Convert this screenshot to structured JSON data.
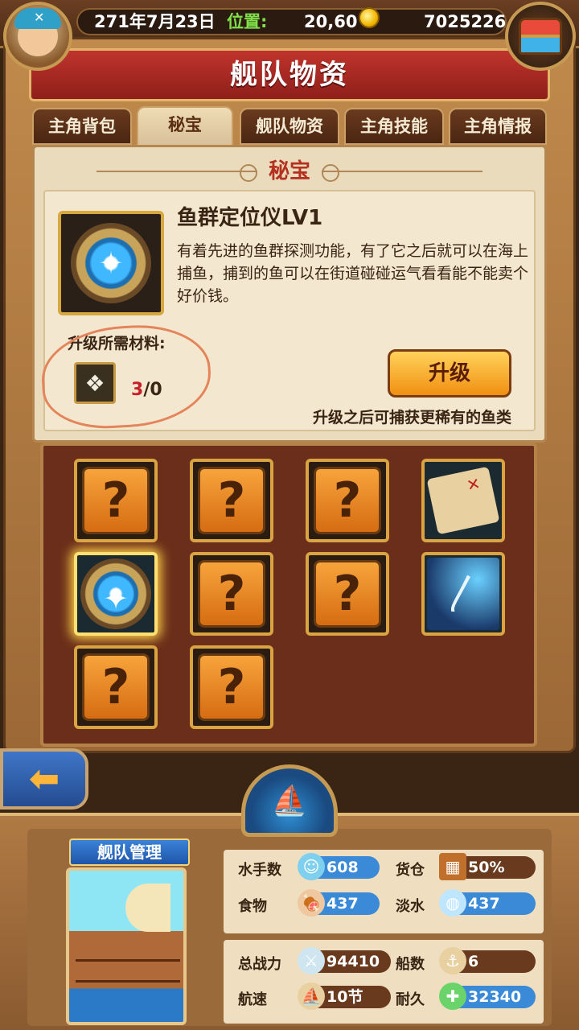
{
  "header": {
    "date": "271年7月23日",
    "position_label": "位置:",
    "position_value": "20,60",
    "gold": "7025226"
  },
  "title": "舰队物资",
  "tabs": [
    {
      "label": "主角背包",
      "active": false
    },
    {
      "label": "秘宝",
      "active": true
    },
    {
      "label": "舰队物资",
      "active": false
    },
    {
      "label": "主角技能",
      "active": false
    },
    {
      "label": "主角情报",
      "active": false
    }
  ],
  "section_title": "秘宝",
  "item": {
    "name": "鱼群定位仪LV1",
    "description": "有着先进的鱼群探测功能，有了它之后就可以在海上捕鱼，捕到的鱼可以在街道碰碰运气看看能不能卖个好价钱。"
  },
  "materials": {
    "label": "升级所需材料:",
    "have": "3",
    "need": "/0"
  },
  "upgrade": {
    "button_label": "升级",
    "note": "升级之后可捕获更稀有的鱼类"
  },
  "slots": [
    {
      "type": "unknown",
      "glyph": "?"
    },
    {
      "type": "unknown",
      "glyph": "?"
    },
    {
      "type": "unknown",
      "glyph": "?"
    },
    {
      "type": "map",
      "glyph": ""
    },
    {
      "type": "compass",
      "glyph": ""
    },
    {
      "type": "unknown",
      "glyph": "?"
    },
    {
      "type": "unknown",
      "glyph": "?"
    },
    {
      "type": "feather",
      "glyph": "〳"
    },
    {
      "type": "unknown",
      "glyph": "?"
    },
    {
      "type": "unknown",
      "glyph": "?"
    }
  ],
  "back_glyph": "⬅",
  "fleet": {
    "banner": "舰队管理",
    "stats": {
      "sailors_label": "水手数",
      "sailors": "608",
      "cargo_label": "货仓",
      "cargo": "50%",
      "food_label": "食物",
      "food": "437",
      "water_label": "淡水",
      "water": "437",
      "power_label": "总战力",
      "power": "94410",
      "ships_label": "船数",
      "ships": "6",
      "speed_label": "航速",
      "speed": "10节",
      "durability_label": "耐久",
      "durability": "32340"
    }
  },
  "colors": {
    "title_red": "#c0342c",
    "accent_orange": "#f09012",
    "pill_blue": "#3a8ad8",
    "highlight_red": "#c8202a",
    "green": "#7fe04a"
  }
}
